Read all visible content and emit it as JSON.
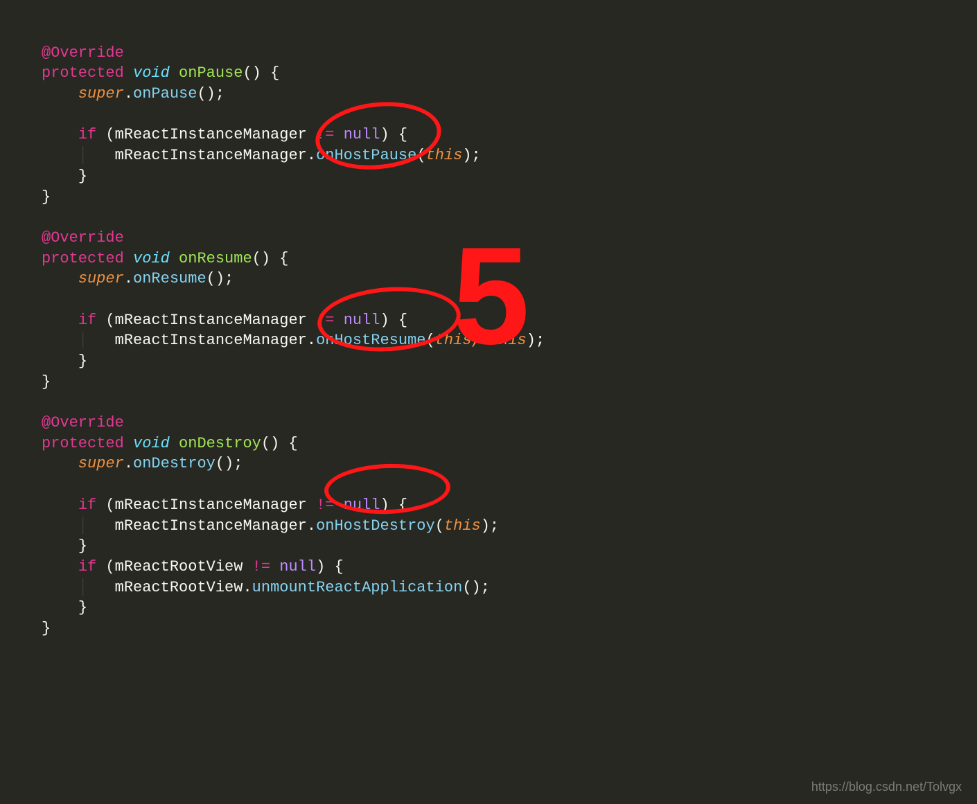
{
  "methods": {
    "override": "@Override",
    "protected": "protected",
    "void": "void",
    "super": "super",
    "if": "if",
    "neq": "!=",
    "null": "null",
    "this": "this",
    "onPause": {
      "name": "onPause",
      "superCall": "onPause",
      "check": "mReactInstanceManager",
      "hostCall": "onHostPause",
      "args": "this"
    },
    "onResume": {
      "name": "onResume",
      "superCall": "onResume",
      "check": "mReactInstanceManager",
      "hostCall": "onHostResume",
      "args": "this, "
    },
    "onDestroy": {
      "name": "onDestroy",
      "superCall": "onDestroy",
      "check": "mReactInstanceManager",
      "hostCall": "onHostDestroy",
      "check2": "mReactRootView",
      "call2obj": "mReactRootView",
      "call2meth": "unmountReactApplication"
    }
  },
  "annotation": {
    "number": "5"
  },
  "watermark": "https://blog.csdn.net/Tolvgx"
}
